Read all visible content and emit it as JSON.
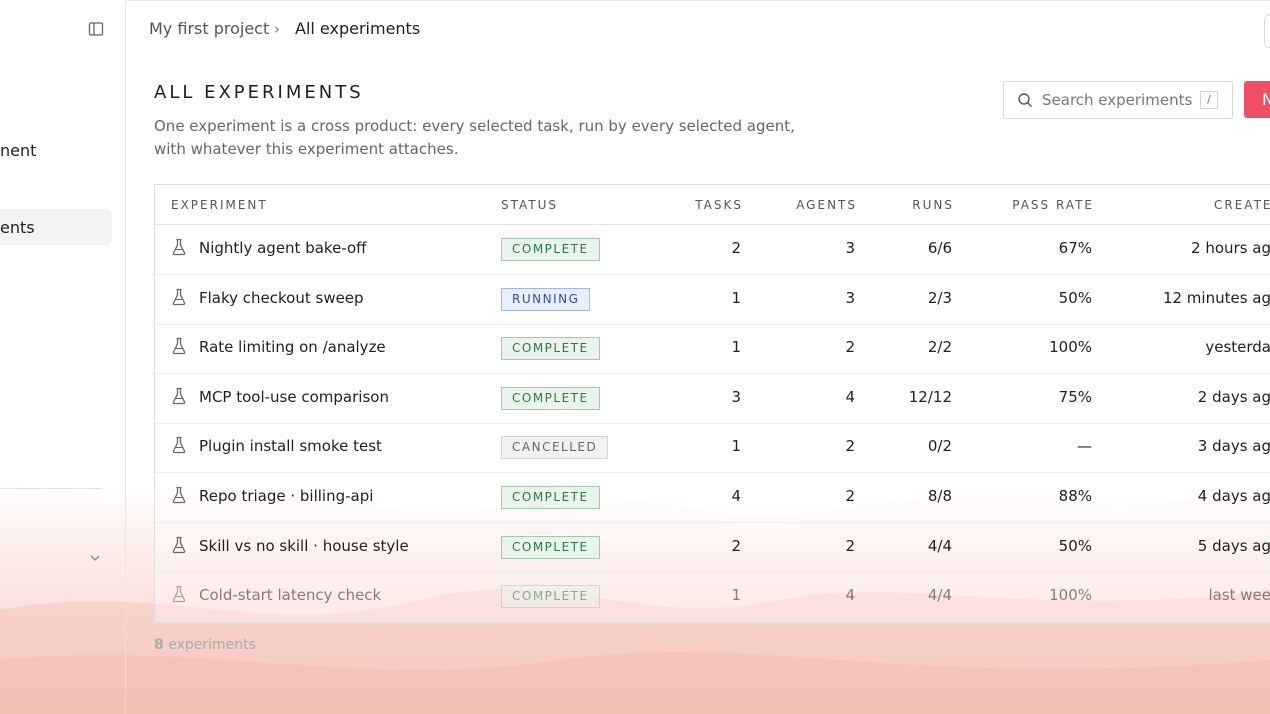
{
  "sidebar": {
    "item_1": "nent",
    "item_2": "ents"
  },
  "breadcrumb": {
    "project": "My first project",
    "separator": "›",
    "current": "All experiments"
  },
  "header": {
    "title": "ALL EXPERIMENTS",
    "description": "One experiment is a cross product: every selected task, run by every selected agent, with whatever this experiment attaches."
  },
  "search": {
    "placeholder": "Search experiments",
    "shortcut": "/"
  },
  "new_button": {
    "label": "N"
  },
  "table": {
    "columns": {
      "experiment": "EXPERIMENT",
      "status": "STATUS",
      "tasks": "TASKS",
      "agents": "AGENTS",
      "runs": "RUNS",
      "pass_rate": "PASS RATE",
      "created": "CREATE"
    },
    "rows": [
      {
        "name": "Nightly agent bake-off",
        "status": "COMPLETE",
        "tasks": "2",
        "agents": "3",
        "runs": "6/6",
        "pass_rate": "67%",
        "created": "2 hours ag"
      },
      {
        "name": "Flaky checkout sweep",
        "status": "RUNNING",
        "tasks": "1",
        "agents": "3",
        "runs": "2/3",
        "pass_rate": "50%",
        "created": "12 minutes ag"
      },
      {
        "name": "Rate limiting on /analyze",
        "status": "COMPLETE",
        "tasks": "1",
        "agents": "2",
        "runs": "2/2",
        "pass_rate": "100%",
        "created": "yesterda"
      },
      {
        "name": "MCP tool-use comparison",
        "status": "COMPLETE",
        "tasks": "3",
        "agents": "4",
        "runs": "12/12",
        "pass_rate": "75%",
        "created": "2 days ag"
      },
      {
        "name": "Plugin install smoke test",
        "status": "CANCELLED",
        "tasks": "1",
        "agents": "2",
        "runs": "0/2",
        "pass_rate": "—",
        "created": "3 days ag"
      },
      {
        "name": "Repo triage · billing-api",
        "status": "COMPLETE",
        "tasks": "4",
        "agents": "2",
        "runs": "8/8",
        "pass_rate": "88%",
        "created": "4 days ag"
      },
      {
        "name": "Skill vs no skill · house style",
        "status": "COMPLETE",
        "tasks": "2",
        "agents": "2",
        "runs": "4/4",
        "pass_rate": "50%",
        "created": "5 days ag"
      },
      {
        "name": "Cold-start latency check",
        "status": "COMPLETE",
        "tasks": "1",
        "agents": "4",
        "runs": "4/4",
        "pass_rate": "100%",
        "created": "last wee"
      }
    ]
  },
  "footer": {
    "count": "8",
    "count_label": "experiments"
  },
  "colors": {
    "accent": "#ef5068",
    "complete": "#2e7a42",
    "running": "#2b4fb4",
    "cancelled": "#666666"
  }
}
